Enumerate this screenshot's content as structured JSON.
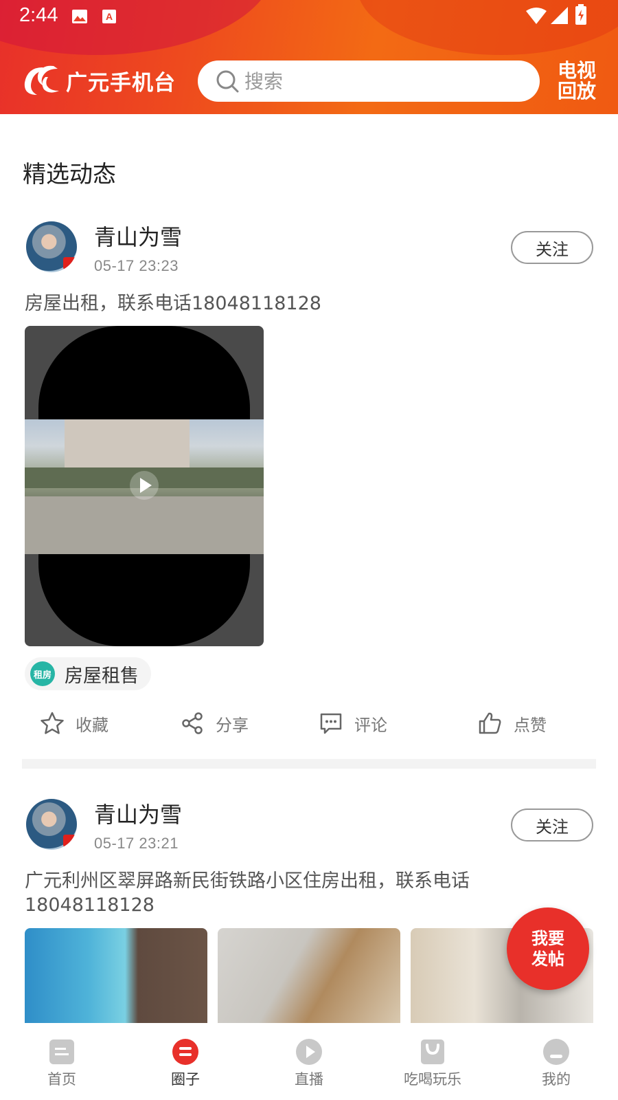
{
  "status_bar": {
    "time": "2:44"
  },
  "header": {
    "app_name": "广元手机台",
    "search_placeholder": "搜索",
    "tv_replay_line1": "电视",
    "tv_replay_line2": "回放"
  },
  "section_title": "精选动态",
  "posts": [
    {
      "username": "青山为雪",
      "time": "05-17 23:23",
      "follow_label": "关注",
      "text": "房屋出租，联系电话18048118128",
      "tag_icon_text": "租房",
      "tag_label": "房屋租售",
      "actions": {
        "favorite": "收藏",
        "share": "分享",
        "comment": "评论",
        "like": "点赞"
      }
    },
    {
      "username": "青山为雪",
      "time": "05-17 23:21",
      "follow_label": "关注",
      "text": "广元利州区翠屏路新民街铁路小区住房出租，联系电话18048118128"
    }
  ],
  "fab": {
    "line1": "我要",
    "line2": "发帖"
  },
  "tabbar": [
    {
      "label": "首页",
      "icon": "home-icon",
      "active": false
    },
    {
      "label": "圈子",
      "icon": "circle-icon",
      "active": true
    },
    {
      "label": "直播",
      "icon": "live-play-icon",
      "active": false
    },
    {
      "label": "吃喝玩乐",
      "icon": "shopping-bag-icon",
      "active": false
    },
    {
      "label": "我的",
      "icon": "profile-icon",
      "active": false
    }
  ],
  "colors": {
    "brand": "#e8302a",
    "brand_orange": "#f36a14",
    "tag_teal": "#27b5a5"
  }
}
